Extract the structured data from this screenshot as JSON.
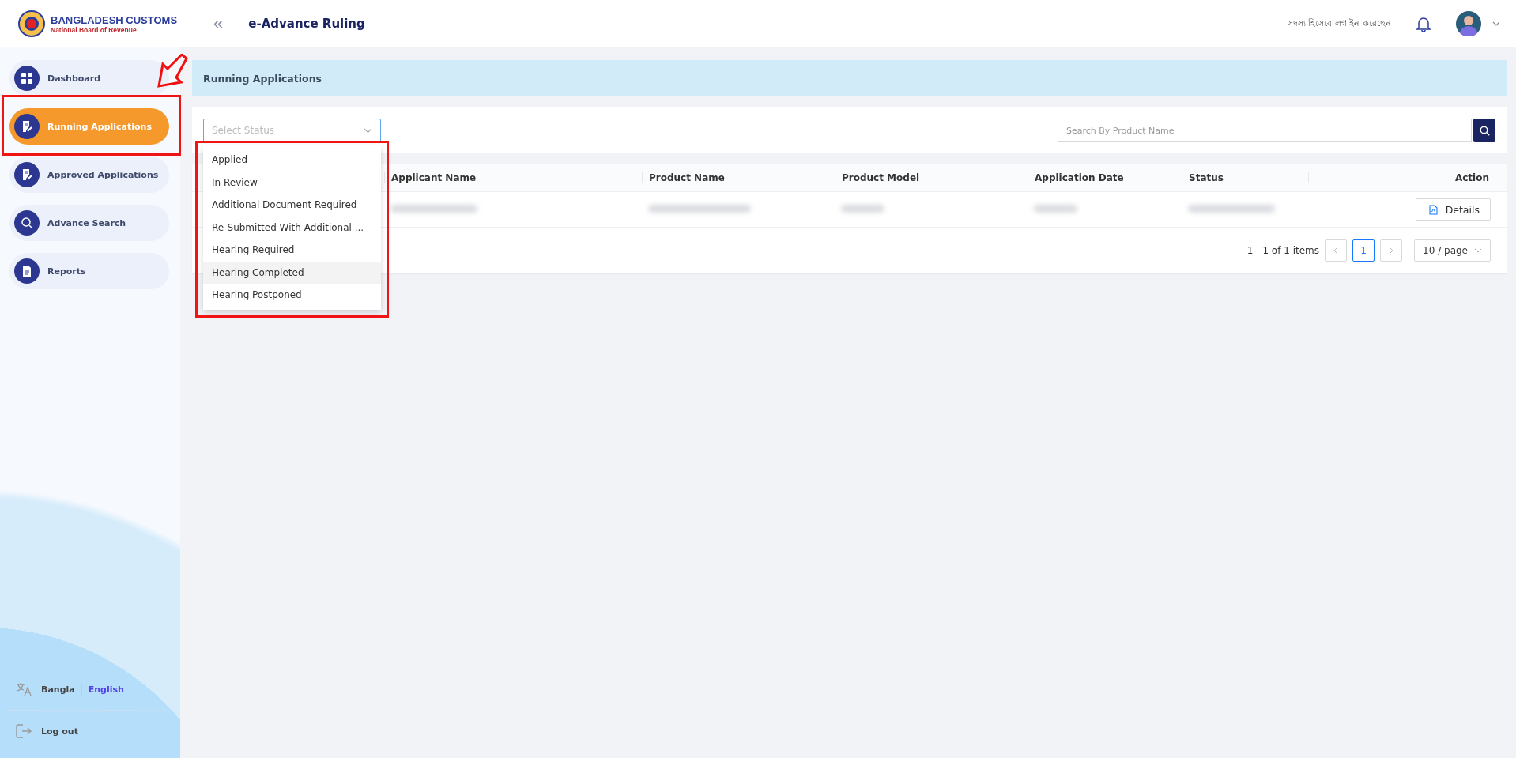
{
  "header": {
    "logo_title": "BANGLADESH CUSTOMS",
    "logo_subtitle": "National Board of Revenue",
    "collapse_icon": "«",
    "app_title": "e-Advance Ruling",
    "login_status": "সদস্য হিসেবে লগ ইন করেছেন"
  },
  "sidebar": {
    "items": [
      {
        "label": "Dashboard",
        "kind": "grid",
        "selected": false
      },
      {
        "label": "Running Applications",
        "kind": "form",
        "selected": true
      },
      {
        "label": "Approved Applications",
        "kind": "form",
        "selected": false
      },
      {
        "label": "Advance Search",
        "kind": "search",
        "selected": false
      },
      {
        "label": "Reports",
        "kind": "report",
        "selected": false
      }
    ],
    "languages": [
      {
        "label": "Bangla",
        "selected": false
      },
      {
        "label": "English",
        "selected": true
      }
    ],
    "logout": "Log out"
  },
  "page_title": "Running Applications",
  "filter": {
    "status_placeholder": "Select Status",
    "search_placeholder": "Search By Product Name",
    "status_options": [
      {
        "label": "Applied",
        "highlighted": false
      },
      {
        "label": "In Review",
        "highlighted": false
      },
      {
        "label": "Additional Document Required",
        "highlighted": false
      },
      {
        "label": "Re-Submitted With Additional ...",
        "highlighted": false
      },
      {
        "label": "Hearing Required",
        "highlighted": false
      },
      {
        "label": "Hearing Completed",
        "highlighted": true
      },
      {
        "label": "Hearing Postponed",
        "highlighted": false
      }
    ]
  },
  "table": {
    "columns": [
      "Applicant Name",
      "Product Name",
      "Product Model",
      "Application Date",
      "Status",
      "Action"
    ],
    "rows": [
      {
        "action": "Details"
      }
    ]
  },
  "pagination": {
    "summary": "1 - 1 of 1 items",
    "pages": [
      {
        "label": "1",
        "selected": true
      }
    ],
    "page_size": "10 / page"
  }
}
